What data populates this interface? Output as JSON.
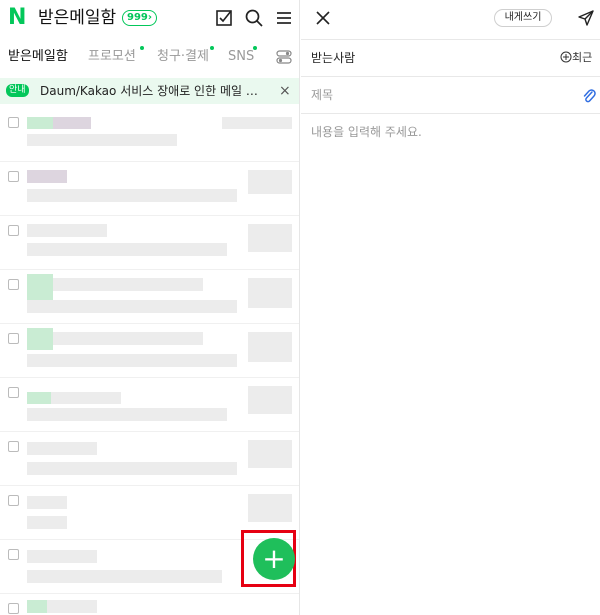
{
  "header": {
    "logo": "N",
    "title": "받은메일함",
    "count": "999›"
  },
  "tabs": [
    {
      "label": "받은메일함",
      "active": true
    },
    {
      "label": "프로모션"
    },
    {
      "label": "청구·결제"
    },
    {
      "label": "SNS"
    }
  ],
  "notice": {
    "badge": "안내",
    "text": "Daum/Kakao 서비스 장애로 인한 메일 발…",
    "close": "×"
  },
  "fab": {
    "icon": "+"
  },
  "compose": {
    "close": "×",
    "self_button": "내게쓰기",
    "to_label": "받는사람",
    "recent_label": "최근",
    "subject_placeholder": "제목",
    "body_placeholder": "내용을 입력해 주세요."
  },
  "colors": {
    "accent": "#03c75a",
    "highlight": "#e60012"
  }
}
